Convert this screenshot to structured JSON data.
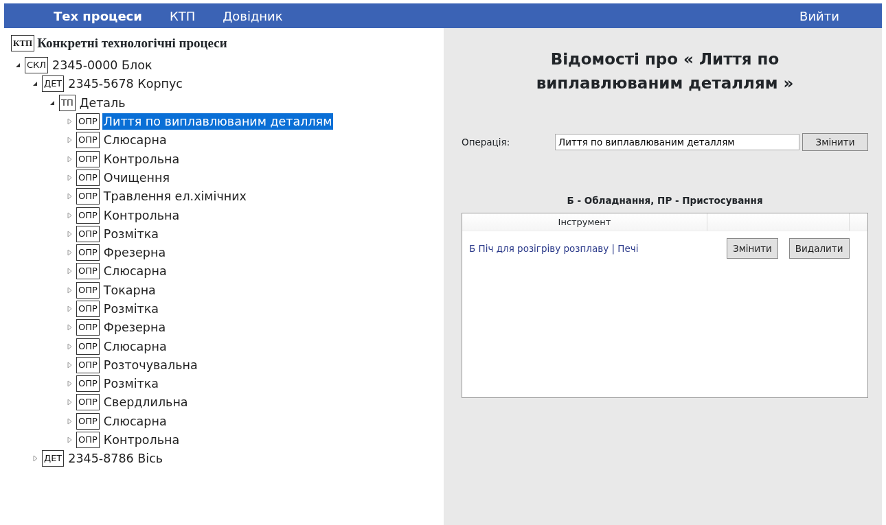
{
  "navbar": {
    "items": [
      {
        "label": "Тех процеси",
        "selected": true
      },
      {
        "label": "КТП",
        "selected": false
      },
      {
        "label": "Довідник",
        "selected": false
      }
    ],
    "logout": "Вийти"
  },
  "tree": {
    "header": {
      "tag": "КТП",
      "label": "Конкретні технологічні процеси"
    },
    "items": [
      {
        "tag": "СКЛ",
        "label": "2345-0000 Блок",
        "expanded": true,
        "selected": false,
        "children": [
          {
            "tag": "ДЕТ",
            "label": "2345-5678 Корпус",
            "expanded": true,
            "selected": false,
            "children": [
              {
                "tag": "ТП",
                "label": "Деталь",
                "expanded": true,
                "selected": false,
                "children": [
                  {
                    "tag": "ОПР",
                    "label": "Лиття по виплавлюваним деталлям",
                    "expanded": false,
                    "selected": true
                  },
                  {
                    "tag": "ОПР",
                    "label": "Слюсарна",
                    "expanded": false,
                    "selected": false
                  },
                  {
                    "tag": "ОПР",
                    "label": "Контрольна",
                    "expanded": false,
                    "selected": false
                  },
                  {
                    "tag": "ОПР",
                    "label": "Очищення",
                    "expanded": false,
                    "selected": false
                  },
                  {
                    "tag": "ОПР",
                    "label": "Травлення ел.хімічних",
                    "expanded": false,
                    "selected": false
                  },
                  {
                    "tag": "ОПР",
                    "label": "Контрольна",
                    "expanded": false,
                    "selected": false
                  },
                  {
                    "tag": "ОПР",
                    "label": "Розмітка",
                    "expanded": false,
                    "selected": false
                  },
                  {
                    "tag": "ОПР",
                    "label": "Фрезерна",
                    "expanded": false,
                    "selected": false
                  },
                  {
                    "tag": "ОПР",
                    "label": "Слюсарна",
                    "expanded": false,
                    "selected": false
                  },
                  {
                    "tag": "ОПР",
                    "label": "Токарна",
                    "expanded": false,
                    "selected": false
                  },
                  {
                    "tag": "ОПР",
                    "label": "Розмітка",
                    "expanded": false,
                    "selected": false
                  },
                  {
                    "tag": "ОПР",
                    "label": "Фрезерна",
                    "expanded": false,
                    "selected": false
                  },
                  {
                    "tag": "ОПР",
                    "label": "Слюсарна",
                    "expanded": false,
                    "selected": false
                  },
                  {
                    "tag": "ОПР",
                    "label": "Розточувальна",
                    "expanded": false,
                    "selected": false
                  },
                  {
                    "tag": "ОПР",
                    "label": "Розмітка",
                    "expanded": false,
                    "selected": false
                  },
                  {
                    "tag": "ОПР",
                    "label": "Свердлильна",
                    "expanded": false,
                    "selected": false
                  },
                  {
                    "tag": "ОПР",
                    "label": "Слюсарна",
                    "expanded": false,
                    "selected": false
                  },
                  {
                    "tag": "ОПР",
                    "label": "Контрольна",
                    "expanded": false,
                    "selected": false
                  }
                ]
              }
            ]
          },
          {
            "tag": "ДЕТ",
            "label": "2345-8786 Вісь",
            "expanded": false,
            "selected": false
          }
        ]
      }
    ]
  },
  "details": {
    "title": "Відомості про « Лиття по виплавлюваним деталлям »",
    "operation": {
      "label": "Операція:",
      "value": "Лиття по виплавлюваним деталлям",
      "button": "Змінити"
    },
    "table_caption": "Б - Обладнання, ПР - Пристосування",
    "table": {
      "columns": [
        "Інструмент"
      ],
      "rows": [
        {
          "text": "Б Піч для розігріву розплаву | Печі",
          "buttons": [
            "Змінити",
            "Видалити"
          ]
        }
      ]
    }
  }
}
